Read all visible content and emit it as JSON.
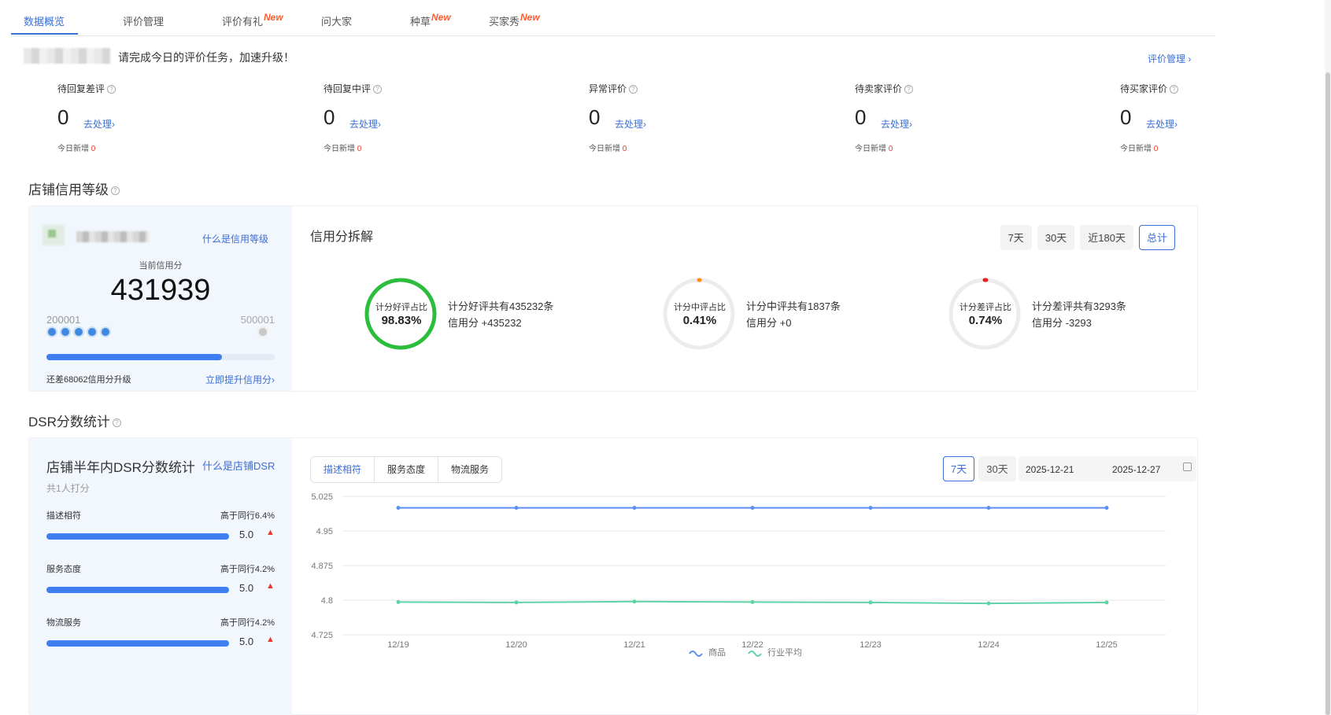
{
  "tabs": [
    {
      "label": "数据概览",
      "new": ""
    },
    {
      "label": "评价管理",
      "new": ""
    },
    {
      "label": "评价有礼",
      "new": "New"
    },
    {
      "label": "问大家",
      "new": ""
    },
    {
      "label": "种草",
      "new": "New"
    },
    {
      "label": "买家秀",
      "new": "New"
    }
  ],
  "task": {
    "message": "请完成今日的评价任务，加速升级！",
    "review_link": "评价管理 ›"
  },
  "stats": [
    {
      "label": "待回复差评",
      "value": "0",
      "action": "去处理›",
      "today_label": "今日新增",
      "today_value": "0"
    },
    {
      "label": "待回复中评",
      "value": "0",
      "action": "去处理›",
      "today_label": "今日新增",
      "today_value": "0"
    },
    {
      "label": "异常评价",
      "value": "0",
      "action": "去处理›",
      "today_label": "今日新增",
      "today_value": "0"
    },
    {
      "label": "待卖家评价",
      "value": "0",
      "action": "去处理›",
      "today_label": "今日新增",
      "today_value": "0"
    },
    {
      "label": "待买家评价",
      "value": "0",
      "action": "去处理›",
      "today_label": "今日新增",
      "today_value": "0"
    }
  ],
  "credit": {
    "section_title": "店铺信用等级",
    "what_link": "什么是信用等级",
    "current_label": "当前信用分",
    "current_score": "431939",
    "level_min": "200001",
    "level_max": "500001",
    "progress": 0.77,
    "upgrade_text": "还差68062信用分升级",
    "raise_link": "立即提升信用分›",
    "breakdown_title": "信用分拆解",
    "ranges": [
      "7天",
      "30天",
      "近180天",
      "总计"
    ],
    "active_range": "总计",
    "rings": [
      {
        "label": "计分好评占比",
        "pct": "98.83%",
        "fraction": 0.9883,
        "color": "#2bbd3c",
        "desc1": "计分好评共有435232条",
        "desc2": "信用分 +435232"
      },
      {
        "label": "计分中评占比",
        "pct": "0.41%",
        "fraction": 0.0041,
        "color": "#ff8c1a",
        "desc1": "计分中评共有1837条",
        "desc2": "信用分 +0"
      },
      {
        "label": "计分差评占比",
        "pct": "0.74%",
        "fraction": 0.0074,
        "color": "#e8221b",
        "desc1": "计分差评共有3293条",
        "desc2": "信用分 -3293"
      }
    ]
  },
  "dsr": {
    "section_title": "DSR分数统计",
    "title": "店铺半年内DSR分数统计",
    "what_link": "什么是店铺DSR",
    "count": "共1人打分",
    "rows": [
      {
        "name": "描述相符",
        "peer": "高于同行6.4%",
        "score": "5.0",
        "trend": "▲"
      },
      {
        "name": "服务态度",
        "peer": "高于同行4.2%",
        "score": "5.0",
        "trend": "▲"
      },
      {
        "name": "物流服务",
        "peer": "高于同行4.2%",
        "score": "5.0",
        "trend": "▲"
      }
    ],
    "segments": [
      "描述相符",
      "服务态度",
      "物流服务"
    ],
    "ranges": [
      "7天",
      "30天"
    ],
    "date_start": "2025-12-21",
    "date_end": "2025-12-27"
  },
  "chart_data": {
    "type": "line",
    "x": [
      "12/19",
      "12/20",
      "12/21",
      "12/22",
      "12/23",
      "12/24",
      "12/25"
    ],
    "yticks": [
      "5.025",
      "4.95",
      "4.875",
      "4.8",
      "4.725"
    ],
    "ylim": [
      4.725,
      5.025
    ],
    "series": [
      {
        "name": "商品",
        "color": "#5b8ff0",
        "values": [
          5.0,
          5.0,
          5.0,
          5.0,
          5.0,
          5.0,
          5.0
        ]
      },
      {
        "name": "行业平均",
        "color": "#5ed3a6",
        "values": [
          4.796,
          4.795,
          4.797,
          4.796,
          4.795,
          4.793,
          4.795
        ]
      }
    ]
  }
}
